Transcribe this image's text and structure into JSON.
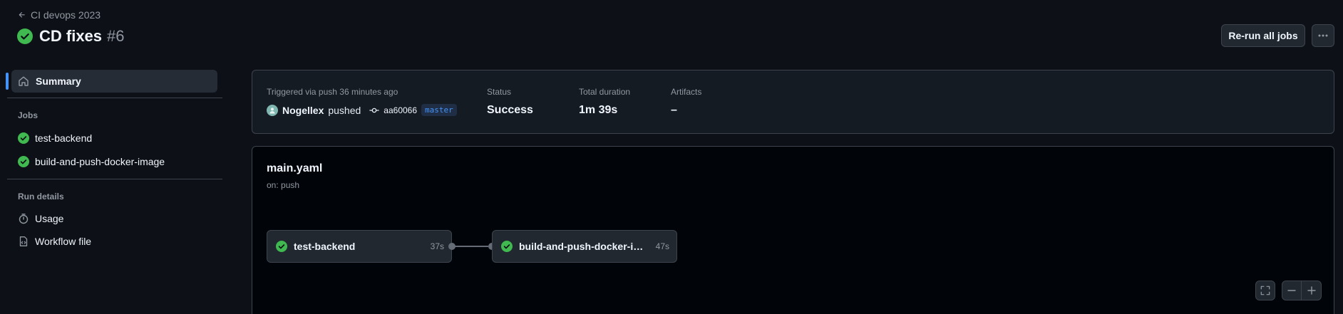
{
  "header": {
    "back_label": "CI devops 2023",
    "title": "CD fixes",
    "run_number": "#6",
    "rerun_label": "Re-run all jobs",
    "more_label": "···"
  },
  "sidebar": {
    "summary_label": "Summary",
    "jobs_heading": "Jobs",
    "jobs": [
      {
        "label": "test-backend",
        "status": "success"
      },
      {
        "label": "build-and-push-docker-image",
        "status": "success"
      }
    ],
    "run_details_heading": "Run details",
    "run_details": [
      {
        "label": "Usage",
        "icon": "stopwatch-icon"
      },
      {
        "label": "Workflow file",
        "icon": "file-code-icon"
      }
    ]
  },
  "info": {
    "trigger_label": "Triggered via push 36 minutes ago",
    "actor": "Nogellex",
    "action": "pushed",
    "commit": "aa60066",
    "branch": "master",
    "status_label": "Status",
    "status_value": "Success",
    "duration_label": "Total duration",
    "duration_value": "1m 39s",
    "artifacts_label": "Artifacts",
    "artifacts_value": "–"
  },
  "workflow": {
    "file": "main.yaml",
    "trigger": "on: push",
    "jobs": [
      {
        "name": "test-backend",
        "duration": "37s"
      },
      {
        "name": "build-and-push-docker-ima...",
        "duration": "47s"
      }
    ]
  },
  "colors": {
    "success": "#3fb950",
    "accent": "#4493f8",
    "background": "#0d1117"
  }
}
